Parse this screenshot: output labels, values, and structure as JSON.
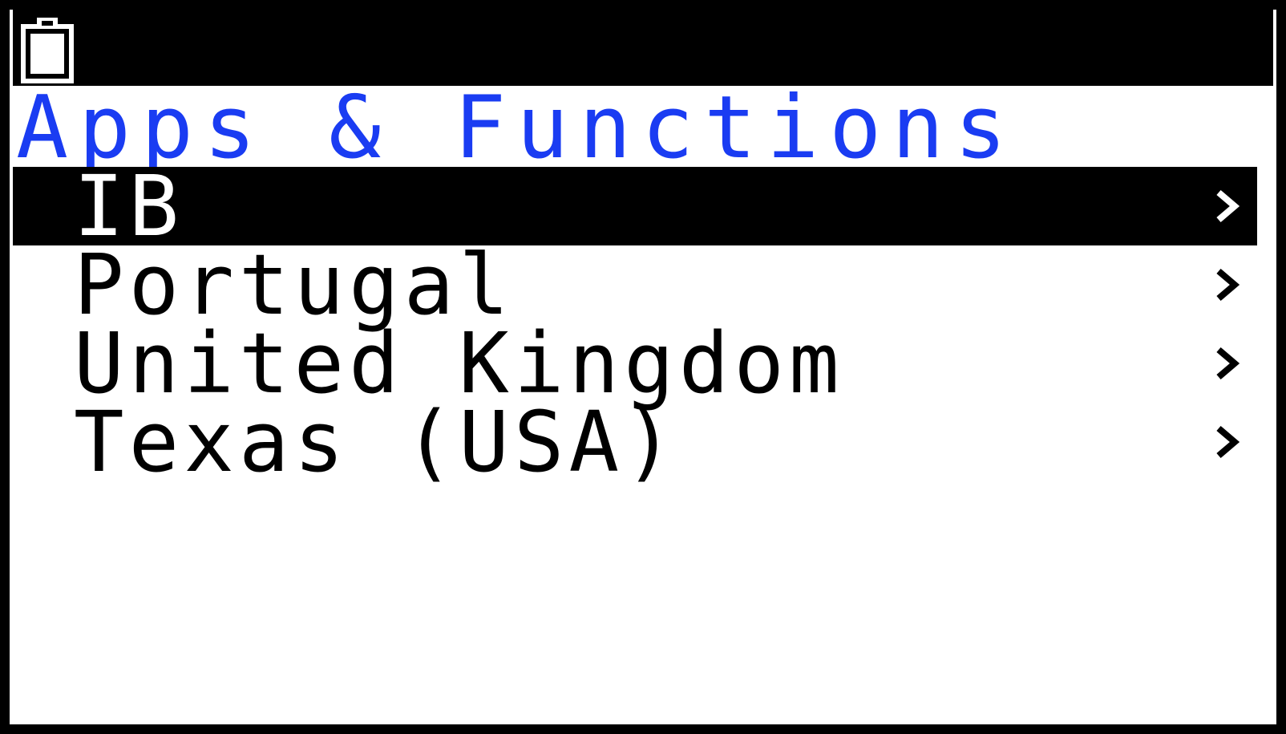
{
  "colors": {
    "title": "#1a3cf2",
    "status_bar": "#000000",
    "background": "#ffffff",
    "selected_bg": "#000000",
    "selected_text": "#ffffff",
    "text": "#000000"
  },
  "status_bar": {
    "icons": [
      "battery-icon"
    ]
  },
  "header": {
    "title": "Apps & Functions"
  },
  "menu": {
    "selected_index": 0,
    "items": [
      {
        "label": "IB",
        "chevron": "›",
        "icon": "chevron-right-icon"
      },
      {
        "label": "Portugal",
        "chevron": "›",
        "icon": "chevron-right-icon"
      },
      {
        "label": "United Kingdom",
        "chevron": "›",
        "icon": "chevron-right-icon"
      },
      {
        "label": "Texas (USA)",
        "chevron": "›",
        "icon": "chevron-right-icon"
      }
    ]
  }
}
